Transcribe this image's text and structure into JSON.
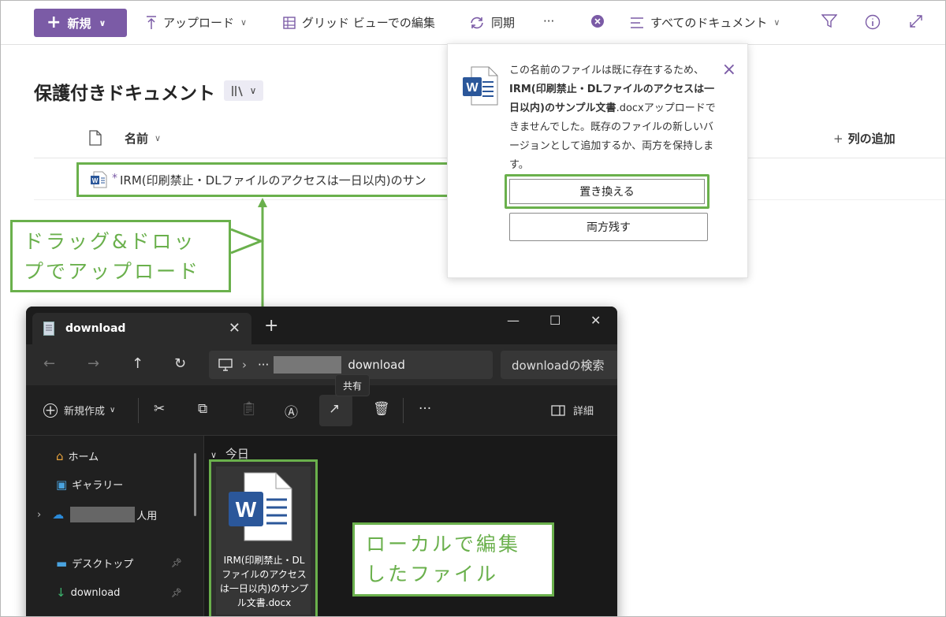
{
  "commandbar": {
    "new_label": "新規",
    "upload_label": "アップロード",
    "grid_edit_label": "グリッド ビューでの編集",
    "sync_label": "同期",
    "more_label": "···",
    "view_label": "すべてのドキュメント"
  },
  "library": {
    "title": "保護付きドキュメント",
    "col_name": "名前",
    "col_add": "列の追加",
    "file_name": "IRM(印刷禁止・DLファイルのアクセスは一日以内)のサン"
  },
  "popup": {
    "msg_1": "この名前のファイルは既に存在するため、",
    "msg_bold": "IRM(印刷禁止・DLファイルのアクセスは一日以内)のサンプル文書",
    "msg_2": ".docxアップロードできませんでした。既存のファイルの新しいバージョンとして追加するか、両方を保持します。",
    "replace_label": "置き換える",
    "keep_both_label": "両方残す"
  },
  "callouts": {
    "drag_drop": "ドラッグ&ドロップでアップロード",
    "local_edit": "ローカルで編集したファイル"
  },
  "explorer": {
    "tab_title": "download",
    "path_leaf": "download",
    "search_placeholder": "downloadの検索",
    "tooltip_share": "共有",
    "new_label": "新規作成",
    "details_label": "詳細",
    "group_today": "今日",
    "sidebar": {
      "home": "ホーム",
      "gallery": "ギャラリー",
      "onedrive_suffix": "人用",
      "desktop": "デスクトップ",
      "download": "download"
    },
    "file_name": "IRM(印刷禁止・DLファイルのアクセスは一日以内)のサンプル文書.docx"
  },
  "colors": {
    "accent": "#7b5ba6",
    "callout_green": "#6ab04c",
    "word_blue": "#2b579a"
  }
}
